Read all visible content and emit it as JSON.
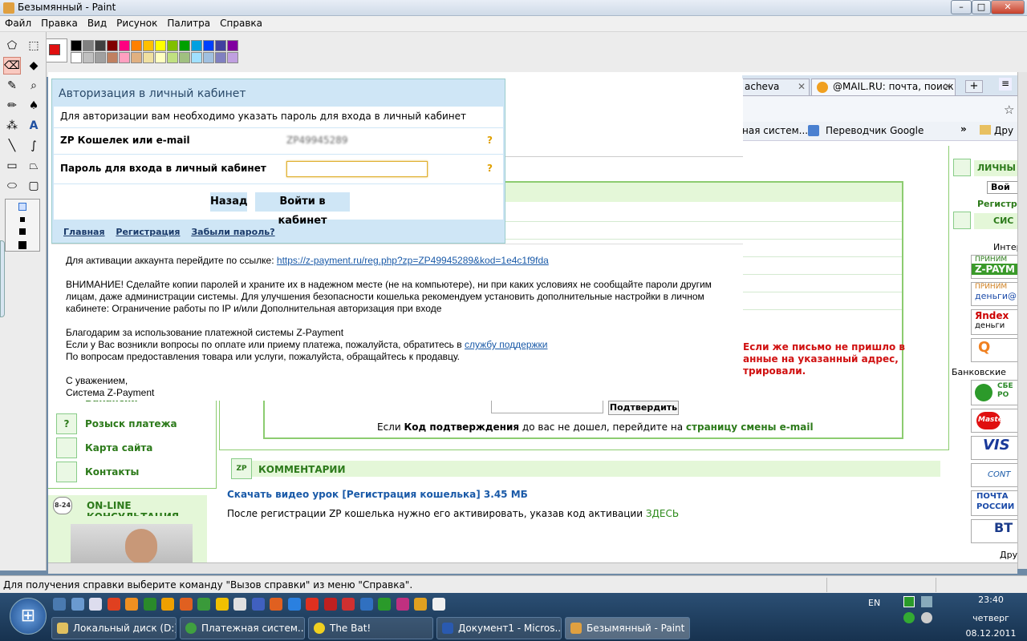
{
  "window": {
    "title": "Безымянный - Paint",
    "btn_min": "–",
    "btn_max": "□",
    "btn_close": "✕"
  },
  "menu": [
    "Файл",
    "Правка",
    "Вид",
    "Рисунок",
    "Палитра",
    "Справка"
  ],
  "palette": {
    "top": [
      "#000000",
      "#808080",
      "#404040",
      "#800000",
      "#ff0080",
      "#ff8000",
      "#ffc000",
      "#ffff00",
      "#80c000",
      "#00a000",
      "#00a0e0",
      "#0040ff",
      "#4040a0",
      "#8000a0"
    ],
    "bottom": [
      "#ffffff",
      "#c0c0c0",
      "#a0a0a0",
      "#c08060",
      "#ffa0c0",
      "#e0b080",
      "#f0e0a0",
      "#ffffc0",
      "#c0e080",
      "#a0c080",
      "#a0e0ff",
      "#a0c0e0",
      "#8080c0",
      "#c0a0e0"
    ],
    "fg": "#e01010"
  },
  "browser": {
    "tab1": "acheva",
    "tab2": "@MAIL.RU: почта, поиск",
    "tab_close": "✕",
    "new_tab": "+",
    "bm1": "ная систем...",
    "bm2": "Переводчик Google",
    "bm_more": "»",
    "bm3": "Дру",
    "star": "☆",
    "tab_menu": "≡",
    "arrows_left": "⇦",
    "arrows_right": "⇨"
  },
  "auth": {
    "title": "Авторизация в личный кабинет",
    "desc": "Для авторизации вам необходимо указать пароль для входа в личный кабинет",
    "wallet_label": "ZP Кошелек или e-mail",
    "wallet_value": "ZP49945289",
    "password_label": "Пароль для входа в личный кабинет",
    "help": "?",
    "btn_back": "Назад",
    "btn_login": "Войти в кабинет",
    "link_home": "Главная",
    "link_reg": "Регистрация",
    "link_forgot": "Забыли пароль?"
  },
  "letter": {
    "line1": "Для активации аккаунта перейдите по ссылке:",
    "link1": "https://z-payment.ru/reg.php?zp=ZP49945289&kod=1e4c1f9fda",
    "warn": "ВНИМАНИЕ! Сделайте копии паролей и храните их в надежном месте (не на компьютере), ни при каких условиях не сообщайте пароли другим лицам, даже администрации системы. Для улучшения безопасности кошелька рекомендуем установить дополнительные настройки в личном кабинете: Ограничение работы по IP и/или Дополнительная авторизация при входе",
    "thanks": "Благодарим за использование платежной системы Z-Payment",
    "q1": "Если у Вас возникли вопросы по оплате или приему платежа, пожалуйста, обратитесь в",
    "q1_link": "службу поддержки",
    "q2": "По вопросам предоставления товара или услуги, пожалуйста, обращайтесь к продавцу.",
    "sign1": "С уважением,",
    "sign2": "Система Z-Payment"
  },
  "sidebar": {
    "partial": "Вакансии",
    "items": [
      "Розыск платежа",
      "Карта сайта",
      "Контакты"
    ],
    "consult": "ON-LINE КОНСУЛЬТАЦИЯ",
    "consult_badge": "8-24"
  },
  "center": {
    "red_text": [
      "Если же письмо не пришло в",
      "анные на указанный адрес,",
      "трировали."
    ],
    "confirm_btn": "Подтвердить",
    "code_note_pre": "Если",
    "code_note_bold": "Код подтверждения",
    "code_note_mid": "до вас не дошел, перейдите на",
    "code_note_link": "страницу смены e-mail",
    "comments_title": "КОММЕНТАРИИ",
    "comments_badge": "ZP",
    "video_link": "Скачать видео урок [Регистрация кошелька] 3.45 МБ",
    "activation_pre": "После регистрации ZP кошелька нужно его активировать, указав код активации",
    "activation_link": "ЗДЕСЬ"
  },
  "right": {
    "personal": "ЛИЧНЫ",
    "login_btn": "Вой",
    "reg": "Регистр",
    "sis": "СИС",
    "inter": "Интер",
    "accept1": "ПРИНИМ",
    "zpay": "Z-PAYM",
    "accept2": "ПРИНИМ",
    "dengi": "деньги@",
    "yandex": "Яndex",
    "yandex2": "деньги",
    "qiwi": "Q",
    "bank": "Банковские",
    "sber": "СБЕ",
    "sber2": "РО",
    "master": "Master",
    "visa": "VIS",
    "contact": "CONT",
    "pochta": "ПОЧТА",
    "pochta2": "РОССИИ",
    "vtb": "ВТ",
    "other": "Друг"
  },
  "status": "Для получения справки выберите команду \"Вызов справки\" из меню \"Справка\".",
  "taskbar": {
    "start_glyph": "⊞",
    "tasks": [
      "Локальный диск (D:)",
      "Платежная систем...",
      "The Bat!",
      "Документ1 - Micros...",
      "Безымянный - Paint"
    ],
    "lang": "EN",
    "time": "23:40",
    "day": "четверг",
    "date": "08.12.2011"
  }
}
